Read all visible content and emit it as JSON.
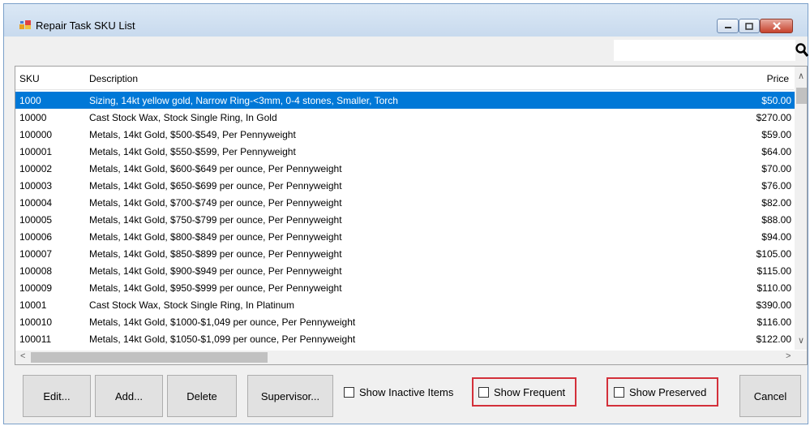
{
  "window": {
    "title": "Repair Task SKU List"
  },
  "search": {
    "value": "",
    "placeholder": ""
  },
  "table": {
    "columns": {
      "sku": "SKU",
      "description": "Description",
      "price": "Price"
    },
    "rows": [
      {
        "sku": "1000",
        "description": "Sizing, 14kt yellow gold, Narrow Ring-<3mm, 0-4 stones, Smaller, Torch",
        "price": "$50.00",
        "selected": true
      },
      {
        "sku": "10000",
        "description": "Cast Stock Wax, Stock Single Ring, In Gold",
        "price": "$270.00"
      },
      {
        "sku": "100000",
        "description": "Metals, 14kt Gold, $500-$549, Per Pennyweight",
        "price": "$59.00"
      },
      {
        "sku": "100001",
        "description": "Metals, 14kt Gold, $550-$599, Per Pennyweight",
        "price": "$64.00"
      },
      {
        "sku": "100002",
        "description": "Metals, 14kt Gold, $600-$649 per ounce, Per Pennyweight",
        "price": "$70.00"
      },
      {
        "sku": "100003",
        "description": "Metals, 14kt Gold, $650-$699 per ounce, Per Pennyweight",
        "price": "$76.00"
      },
      {
        "sku": "100004",
        "description": "Metals, 14kt Gold, $700-$749 per ounce, Per Pennyweight",
        "price": "$82.00"
      },
      {
        "sku": "100005",
        "description": "Metals, 14kt Gold, $750-$799 per ounce, Per Pennyweight",
        "price": "$88.00"
      },
      {
        "sku": "100006",
        "description": "Metals, 14kt Gold, $800-$849 per ounce, Per Pennyweight",
        "price": "$94.00"
      },
      {
        "sku": "100007",
        "description": "Metals, 14kt Gold, $850-$899 per ounce, Per Pennyweight",
        "price": "$105.00"
      },
      {
        "sku": "100008",
        "description": "Metals, 14kt Gold, $900-$949 per ounce, Per Pennyweight",
        "price": "$115.00"
      },
      {
        "sku": "100009",
        "description": "Metals, 14kt Gold, $950-$999 per ounce, Per Pennyweight",
        "price": "$110.00"
      },
      {
        "sku": "10001",
        "description": "Cast Stock Wax, Stock Single Ring, In Platinum",
        "price": "$390.00"
      },
      {
        "sku": "100010",
        "description": "Metals, 14kt Gold, $1000-$1,049 per ounce, Per Pennyweight",
        "price": "$116.00"
      },
      {
        "sku": "100011",
        "description": "Metals, 14kt Gold, $1050-$1,099 per ounce, Per Pennyweight",
        "price": "$122.00"
      }
    ]
  },
  "buttons": {
    "edit": "Edit...",
    "add": "Add...",
    "delete": "Delete",
    "supervisor": "Supervisor...",
    "cancel": "Cancel"
  },
  "checkboxes": {
    "show_inactive": "Show Inactive Items",
    "show_frequent": "Show Frequent",
    "show_preserved": "Show Preserved"
  },
  "colors": {
    "selection": "#0078d7",
    "highlight_frame": "#d3303a"
  },
  "icons": {
    "app": "app-icon",
    "search": "search-icon",
    "minimize": "minimize-icon",
    "maximize": "maximize-icon",
    "close": "close-icon"
  }
}
